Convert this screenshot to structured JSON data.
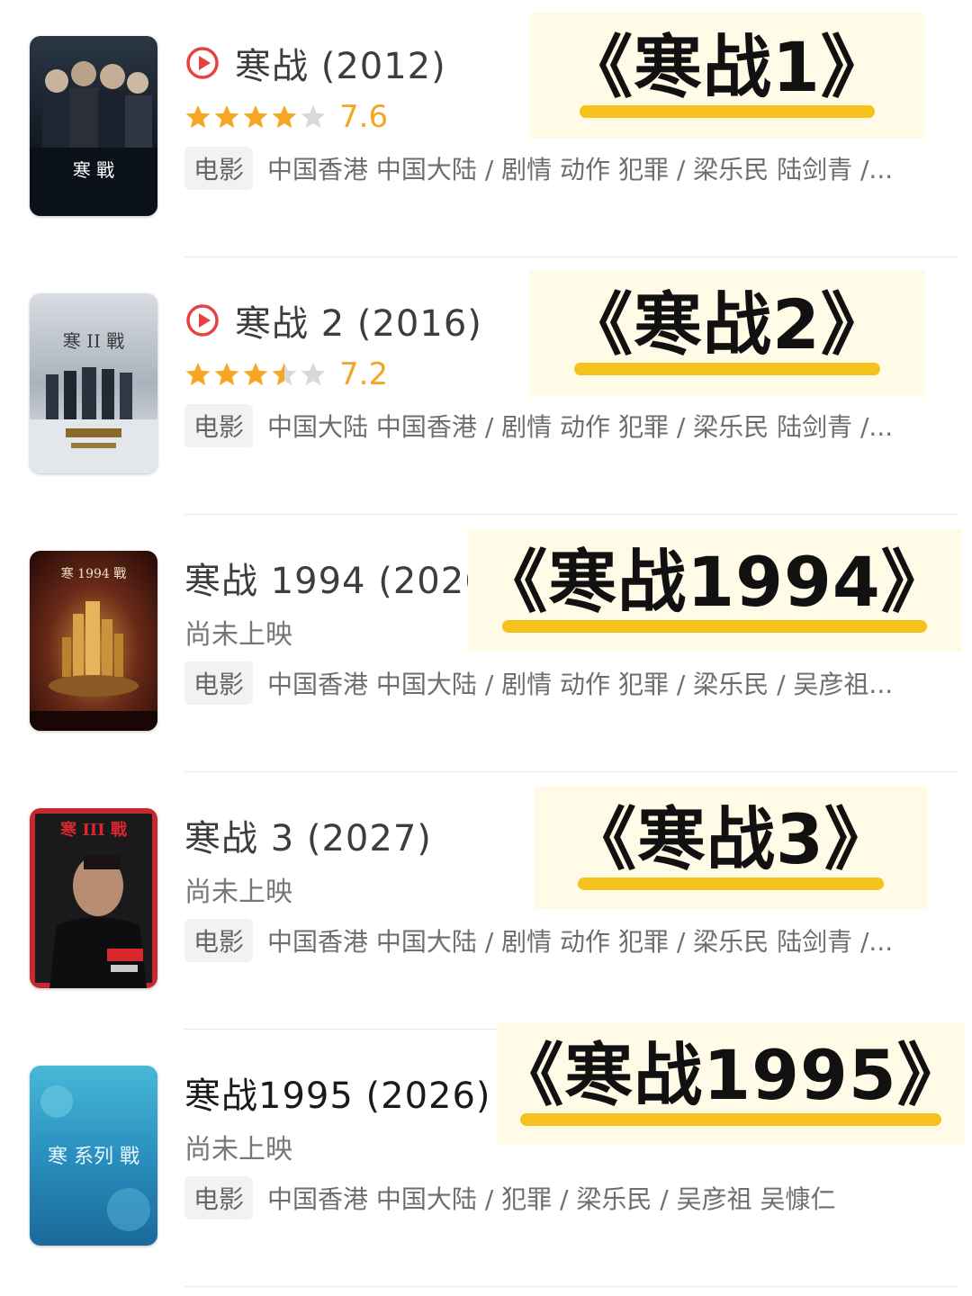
{
  "colors": {
    "play_red": "#e8413e",
    "star_gold": "#f5a623",
    "star_gray": "#d9d9d9",
    "score_gold": "#f2a623",
    "highlight": "#f6c21c"
  },
  "movies": [
    {
      "title": "寒战 (2012)",
      "play_icon": "play-circle-icon",
      "rating_stars": 4,
      "score": "7.6",
      "status": "",
      "tag": "电影",
      "meta": "中国香港 中国大陆 / 剧情 动作 犯罪 / 梁乐民 陆剑青 /...",
      "overlay": "《寒战1》",
      "poster_text": "寒 戰"
    },
    {
      "title": "寒战 2 (2016)",
      "play_icon": "play-circle-icon",
      "rating_stars": 3.5,
      "score": "7.2",
      "status": "",
      "tag": "电影",
      "meta": "中国大陆 中国香港 / 剧情 动作 犯罪 / 梁乐民 陆剑青 /...",
      "overlay": "《寒战2》",
      "poster_text": "寒 II 戰"
    },
    {
      "title": "寒战 1994 (2026",
      "status": "尚未上映",
      "tag": "电影",
      "meta": "中国香港 中国大陆 / 剧情 动作 犯罪 / 梁乐民 / 吴彦祖...",
      "overlay": "《寒战1994》",
      "poster_text": "寒 1994 戰"
    },
    {
      "title": "寒战 3 (2027)",
      "status": "尚未上映",
      "tag": "电影",
      "meta": "中国香港 中国大陆 / 剧情 动作 犯罪 / 梁乐民 陆剑青 /...",
      "overlay": "《寒战3》",
      "poster_text": "寒 III 戰"
    },
    {
      "title": "寒战1995 (2026)",
      "status": "尚未上映",
      "tag": "电影",
      "meta": "中国香港 中国大陆 / 犯罪 / 梁乐民 / 吴彦祖 吴慷仁",
      "overlay": "《寒战1995》",
      "poster_text": "寒 系列 戰"
    }
  ]
}
